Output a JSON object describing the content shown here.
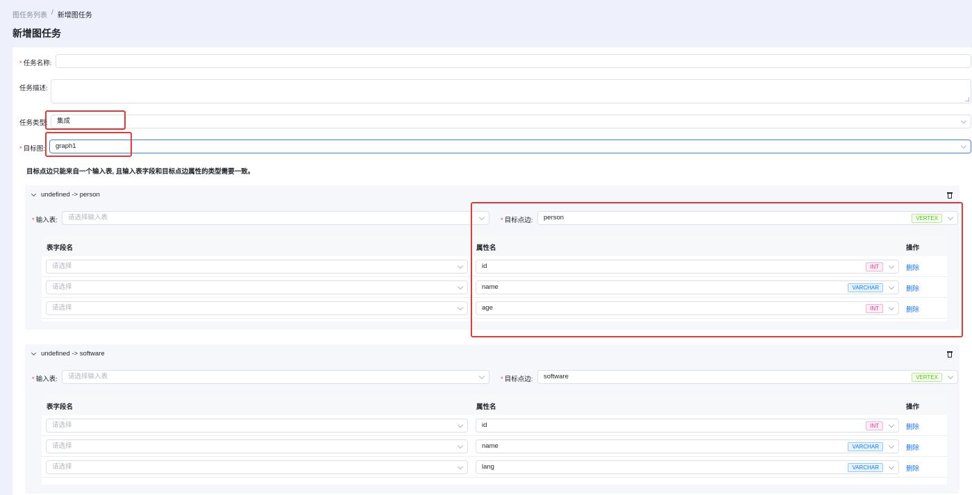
{
  "breadcrumb": {
    "parent": "图任务列表",
    "separator": "/",
    "current": "新增图任务"
  },
  "page_title": "新增图任务",
  "form": {
    "task_name": {
      "label": "任务名称:",
      "value": ""
    },
    "task_desc": {
      "label": "任务描述:",
      "value": ""
    },
    "task_type": {
      "label": "任务类型:",
      "value": "集成"
    },
    "target_graph": {
      "label": "目标图:",
      "value": "graph1"
    },
    "hint": "目标点边只能来自一个输入表, 且输入表字段和目标点边属性的类型需要一致。"
  },
  "mappings": [
    {
      "title": "undefined -> person",
      "input_label": "输入表:",
      "input_placeholder": "请选择输入表",
      "target_label": "目标点边:",
      "target_value": "person",
      "target_tag": "VERTEX",
      "columns": {
        "field": "表字段名",
        "property": "属性名",
        "action": "操作"
      },
      "rows": [
        {
          "field_placeholder": "请选择",
          "property": "id",
          "type": "INT",
          "action": "删除"
        },
        {
          "field_placeholder": "请选择",
          "property": "name",
          "type": "VARCHAR",
          "action": "删除"
        },
        {
          "field_placeholder": "请选择",
          "property": "age",
          "type": "INT",
          "action": "删除"
        }
      ]
    },
    {
      "title": "undefined -> software",
      "input_label": "输入表:",
      "input_placeholder": "请选择输入表",
      "target_label": "目标点边:",
      "target_value": "software",
      "target_tag": "VERTEX",
      "columns": {
        "field": "表字段名",
        "property": "属性名",
        "action": "操作"
      },
      "rows": [
        {
          "field_placeholder": "请选择",
          "property": "id",
          "type": "INT",
          "action": "删除"
        },
        {
          "field_placeholder": "请选择",
          "property": "name",
          "type": "VARCHAR",
          "action": "删除"
        },
        {
          "field_placeholder": "请选择",
          "property": "lang",
          "type": "VARCHAR",
          "action": "删除"
        }
      ]
    }
  ],
  "colors": {
    "accent": "#1677ff",
    "required": "#f53f3f",
    "highlight_box": "#e53935"
  }
}
